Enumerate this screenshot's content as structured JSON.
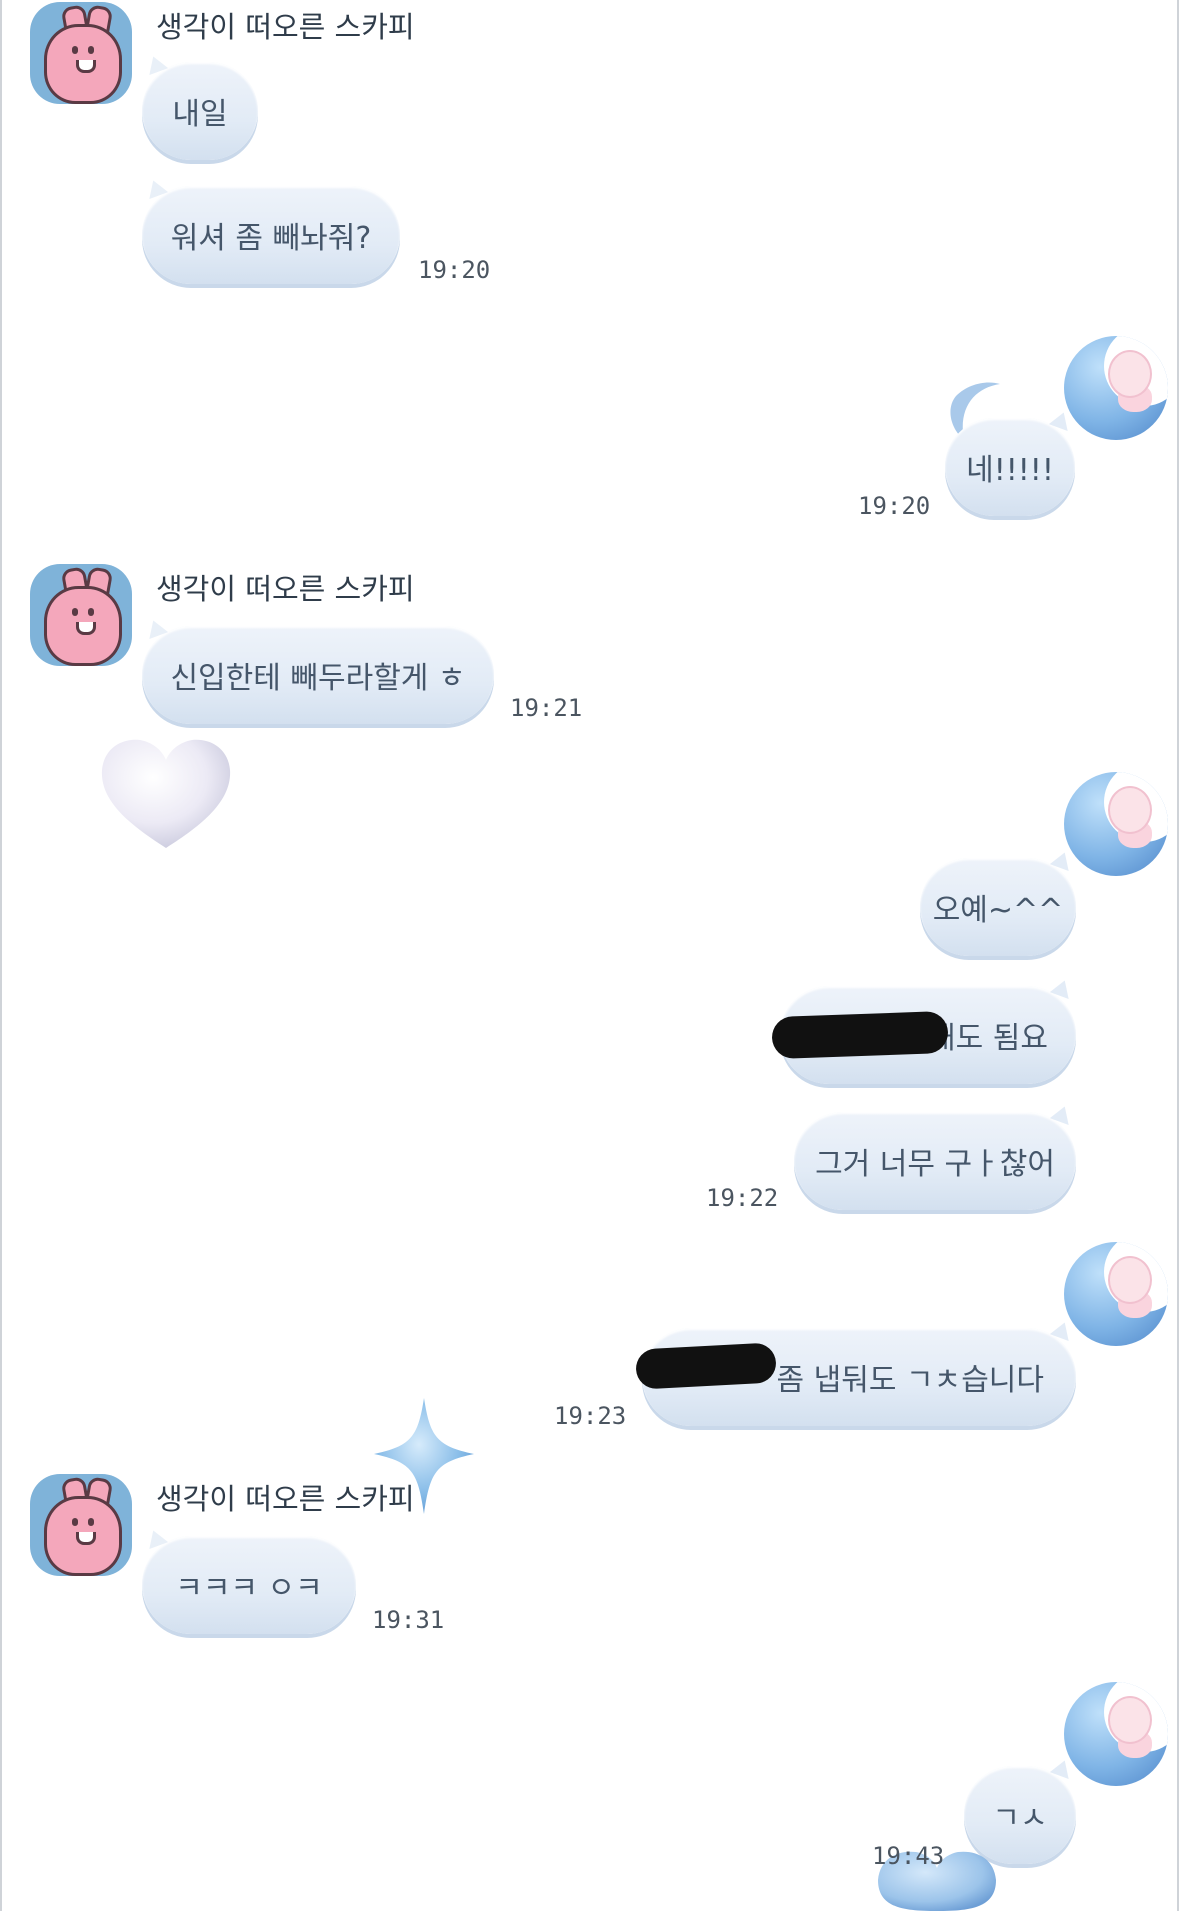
{
  "chat": {
    "sender_name": "생각이 떠오른 스카피",
    "messages": [
      {
        "side": "in",
        "text": "내일"
      },
      {
        "side": "in",
        "text": "워셔 좀 빼놔줘?",
        "time": "19:20"
      },
      {
        "side": "out",
        "text": "네!!!!!",
        "time": "19:20"
      },
      {
        "side": "in",
        "text": "신입한테 빼두라할게 ㅎ",
        "time": "19:21"
      },
      {
        "side": "out",
        "text": "오예~^^"
      },
      {
        "side": "out",
        "text": "해도 됨요"
      },
      {
        "side": "out",
        "text": "그거 너무 구ㅏ찮어",
        "time": "19:22"
      },
      {
        "side": "out",
        "text": "좀 냅둬도 ㄱㅊ습니다",
        "time": "19:23"
      },
      {
        "side": "in",
        "text": "ㅋㅋㅋ ㅇㅋ",
        "time": "19:31"
      },
      {
        "side": "out",
        "text": "ㄱㅅ",
        "time": "19:43"
      }
    ]
  },
  "icons": {
    "sender_avatar": "pink-bunny-avatar",
    "my_avatar": "baby-on-moon-avatar",
    "heart": "white-3d-heart",
    "sparkle": "blue-sparkle-star"
  },
  "colors": {
    "bubble": "#e2ebf6",
    "avatar_bg": "#7fb3d9",
    "text": "#45566a"
  }
}
